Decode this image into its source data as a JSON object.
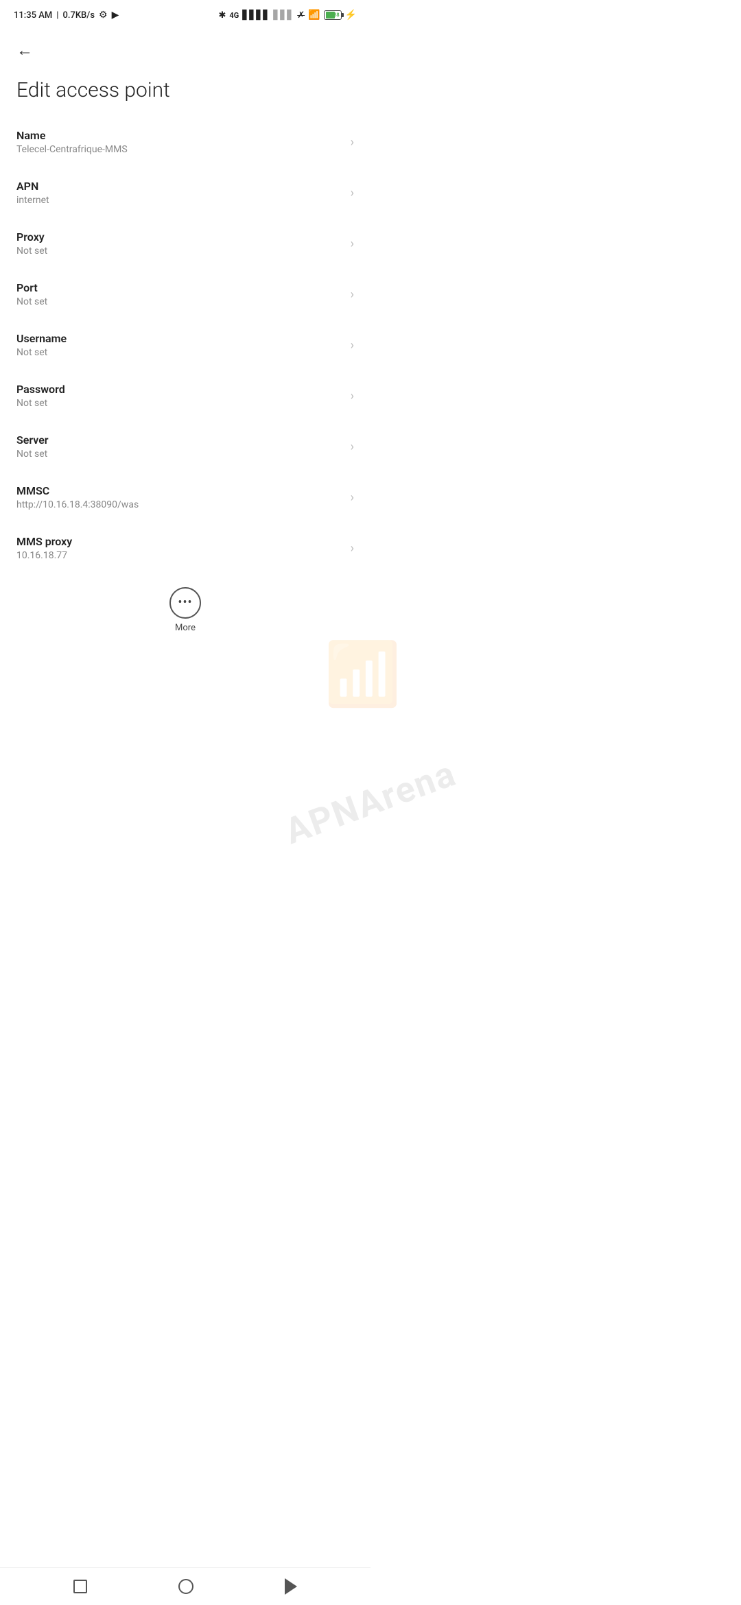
{
  "statusBar": {
    "time": "11:35 AM",
    "speed": "0.7KB/s"
  },
  "page": {
    "title": "Edit access point",
    "backLabel": "←"
  },
  "settings": [
    {
      "label": "Name",
      "value": "Telecel-Centrafrique-MMS"
    },
    {
      "label": "APN",
      "value": "internet"
    },
    {
      "label": "Proxy",
      "value": "Not set"
    },
    {
      "label": "Port",
      "value": "Not set"
    },
    {
      "label": "Username",
      "value": "Not set"
    },
    {
      "label": "Password",
      "value": "Not set"
    },
    {
      "label": "Server",
      "value": "Not set"
    },
    {
      "label": "MMSC",
      "value": "http://10.16.18.4:38090/was"
    },
    {
      "label": "MMS proxy",
      "value": "10.16.18.77"
    }
  ],
  "more": {
    "label": "More"
  },
  "watermark": {
    "text": "APNArena"
  }
}
